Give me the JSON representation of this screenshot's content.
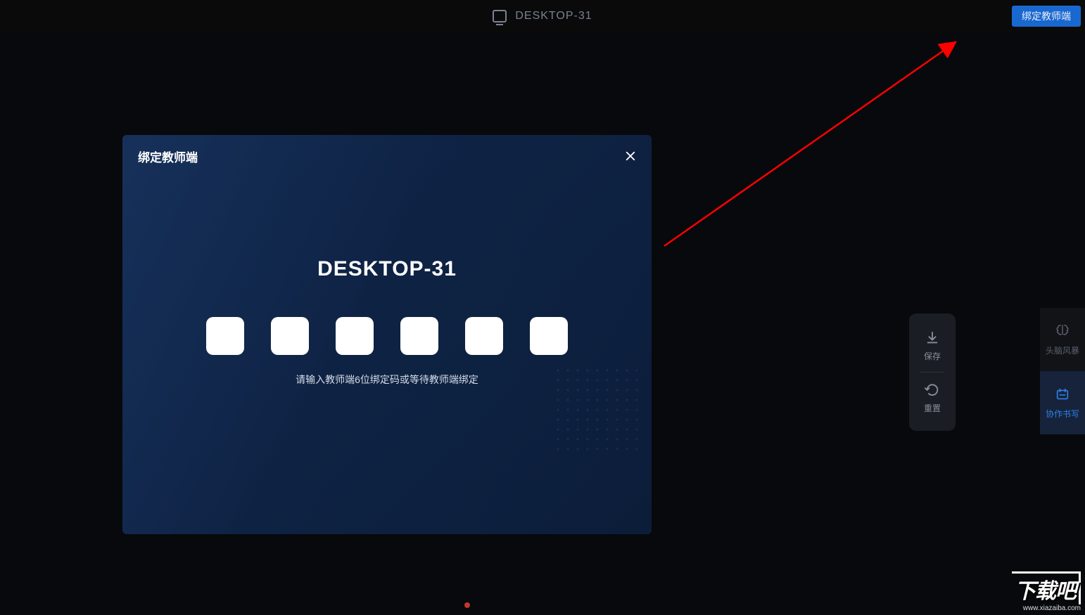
{
  "header": {
    "device_name": "DESKTOP-31",
    "bind_button": "绑定教师端"
  },
  "modal": {
    "title": "绑定教师端",
    "device_name": "DESKTOP-31",
    "hint": "请输入教师端6位绑定码或等待教师端绑定",
    "code_values": [
      "",
      "",
      "",
      "",
      "",
      ""
    ]
  },
  "toolbar": {
    "save_label": "保存",
    "reset_label": "重置"
  },
  "side_tabs": {
    "brainstorm_label": "头脑风暴",
    "collab_label": "协作书写"
  },
  "watermark": {
    "brand": "下载吧",
    "url": "www.xiazaiba.com"
  },
  "colors": {
    "accent_blue": "#1968d0",
    "active_blue": "#2f7fe8",
    "arrow_red": "#ff0000"
  }
}
